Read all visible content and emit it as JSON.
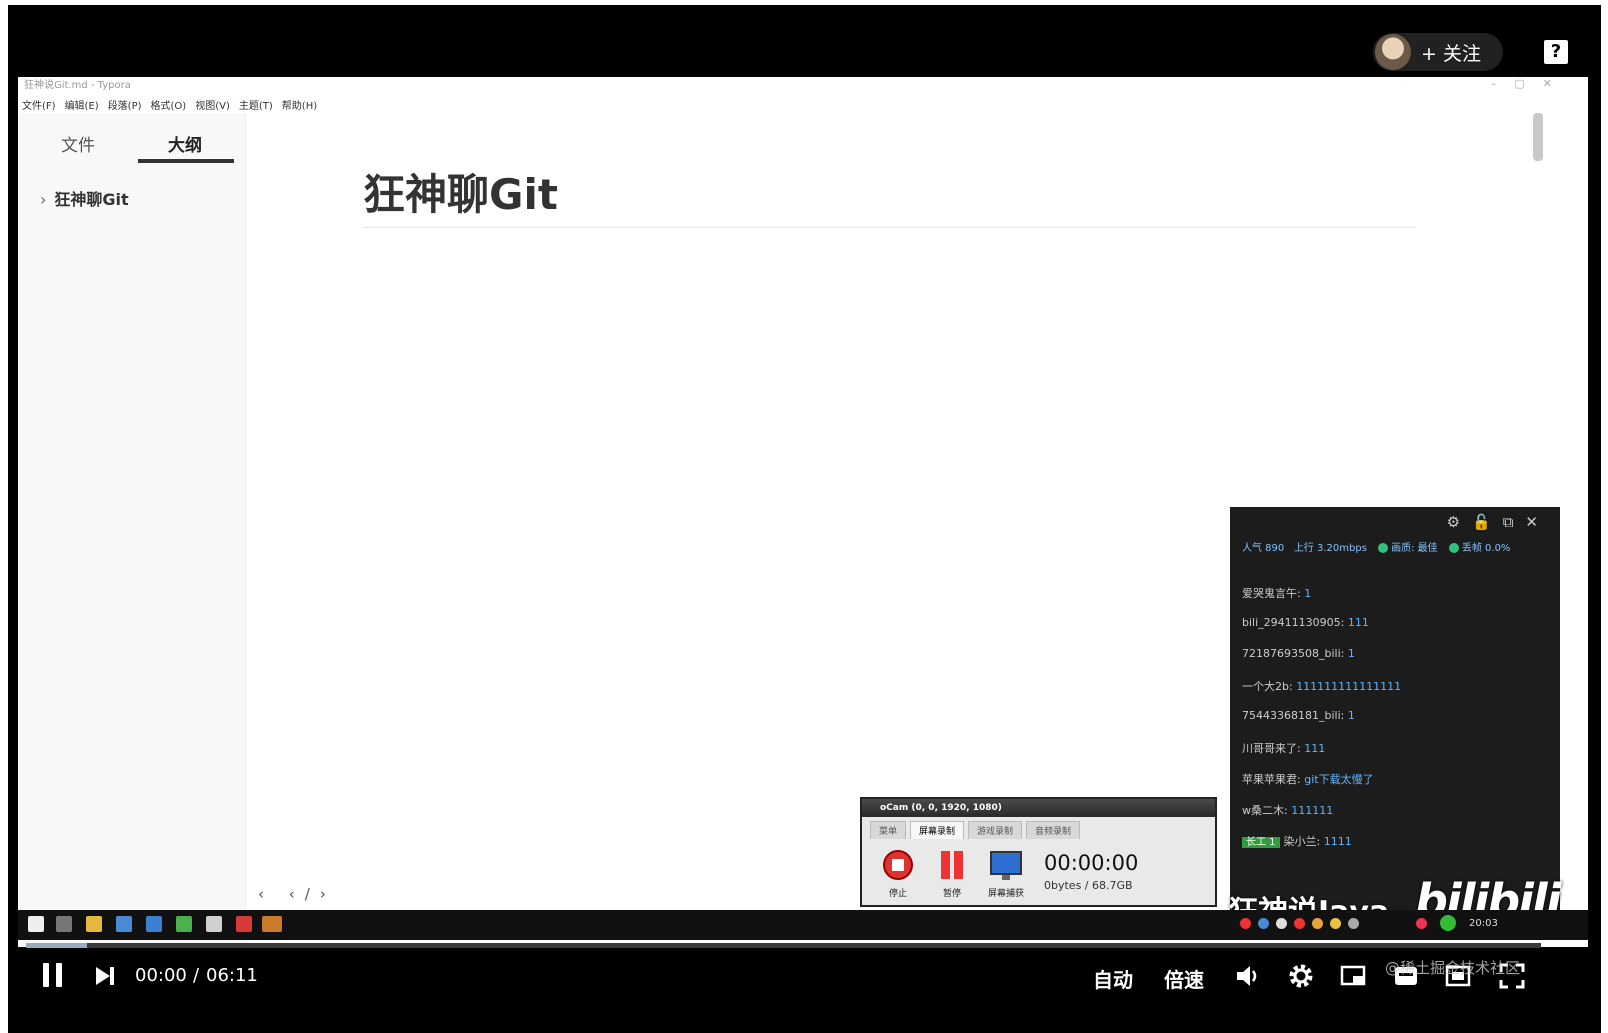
{
  "header": {
    "follow_label": "+ 关注",
    "help_label": "?"
  },
  "editor": {
    "window_title": "狂神说Git.md - Typora",
    "menu": [
      "文件(F)",
      "编辑(E)",
      "段落(P)",
      "格式(O)",
      "视图(V)",
      "主题(T)",
      "帮助(H)"
    ],
    "sidebar_tabs": {
      "files": "文件",
      "outline": "大纲"
    },
    "outline_items": [
      "狂神聊Git"
    ],
    "doc_title": "狂神聊Git"
  },
  "chat": {
    "stats": {
      "popularity": "人气 890",
      "upload": "上行 3.20mbps",
      "quality": "画质: 最佳",
      "drop": "丢帧 0.0%"
    },
    "messages": [
      {
        "user": "爱哭鬼言午:",
        "text": "1"
      },
      {
        "user": "bili_29411130905:",
        "text": "111"
      },
      {
        "user": "72187693508_bili:",
        "text": "1"
      },
      {
        "user": "一个大2b:",
        "text": "111111111111111"
      },
      {
        "user": "75443368181_bili:",
        "text": "1"
      },
      {
        "user": "川哥哥来了:",
        "text": "111"
      },
      {
        "user": "苹果苹果君:",
        "text": "git下载太慢了"
      },
      {
        "user": "w桑二木:",
        "text": "111111"
      },
      {
        "badge": "长工 1",
        "user": "染小兰:",
        "text": "1111"
      }
    ]
  },
  "ocam": {
    "title": "oCam (0, 0, 1920, 1080)",
    "tabs": [
      "菜单",
      "屏幕录制",
      "游戏录制",
      "音频录制"
    ],
    "buttons": {
      "stop": "停止",
      "pause": "暂停",
      "capture": "屏幕捕获"
    },
    "timer": "00:00:00",
    "size": "0bytes / 68.7GB"
  },
  "taskbar": {
    "clock": "20:03"
  },
  "watermark": {
    "text": "狂神说Java",
    "logo": "bilibili"
  },
  "player": {
    "current_time": "00:00",
    "separator": "/",
    "duration": "06:11",
    "auto_label": "自动",
    "speed_label": "倍速",
    "progress": 0.04,
    "site_watermark": "@稀土掘金技术社区"
  }
}
